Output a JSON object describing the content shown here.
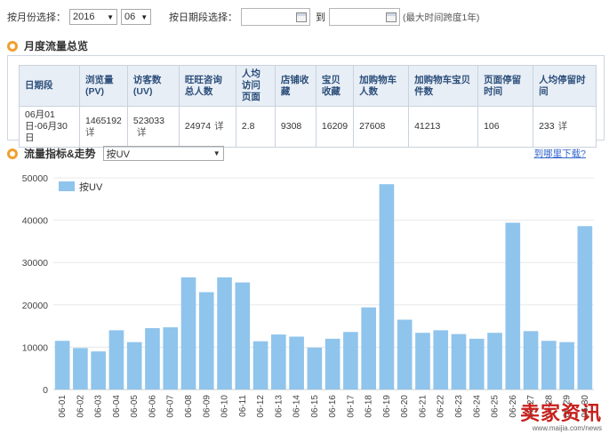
{
  "filter": {
    "month_label": "按月份选择：",
    "year_value": "2016",
    "month_value": "06",
    "date_label": "按日期段选择：",
    "date_start": "",
    "date_sep": "到",
    "date_end": "",
    "hint": "(最大时间跨度1年)"
  },
  "summary": {
    "title": "月度流量总览",
    "headers": [
      "日期段",
      "浏览量 (PV)",
      "访客数 (UV)",
      "旺旺咨询总人数",
      "人均访问页面",
      "店铺收藏",
      "宝贝收藏",
      "加购物车人数",
      "加购物车宝贝件数",
      "页面停留时间",
      "人均停留时间"
    ],
    "row": [
      "06月01日-06月30日",
      "1465192",
      "523033",
      "24974",
      "2.8",
      "9308",
      "16209",
      "27608",
      "41213",
      "106",
      "233"
    ],
    "detail_label": "详"
  },
  "trend": {
    "title": "流量指标&走势",
    "select_value": "按UV",
    "download_label": "到哪里下载?"
  },
  "chart_data": {
    "type": "bar",
    "categories": [
      "06-01",
      "06-02",
      "06-03",
      "06-04",
      "06-05",
      "06-06",
      "06-07",
      "06-08",
      "06-09",
      "06-10",
      "06-11",
      "06-12",
      "06-13",
      "06-14",
      "06-15",
      "06-16",
      "06-17",
      "06-18",
      "06-19",
      "06-20",
      "06-21",
      "06-22",
      "06-23",
      "06-24",
      "06-25",
      "06-26",
      "06-27",
      "06-28",
      "06-29",
      "06-30"
    ],
    "series": [
      {
        "name": "按UV",
        "values": [
          11500,
          9800,
          9000,
          14000,
          11200,
          14500,
          14700,
          26500,
          23000,
          26500,
          25300,
          11400,
          13000,
          12500,
          9900,
          12000,
          13600,
          19400,
          48500,
          16500,
          13400,
          14000,
          13100,
          12000,
          13400,
          39400,
          13800,
          11500,
          11200,
          38600
        ]
      }
    ],
    "ylim": [
      0,
      50000
    ],
    "yticks": [
      0,
      10000,
      20000,
      30000,
      40000,
      50000
    ],
    "grid": true,
    "legend": "top-left",
    "bar_color": "#8fc4ec"
  },
  "watermark": {
    "text": "卖家资讯",
    "url": "www.maijia.com/news"
  }
}
